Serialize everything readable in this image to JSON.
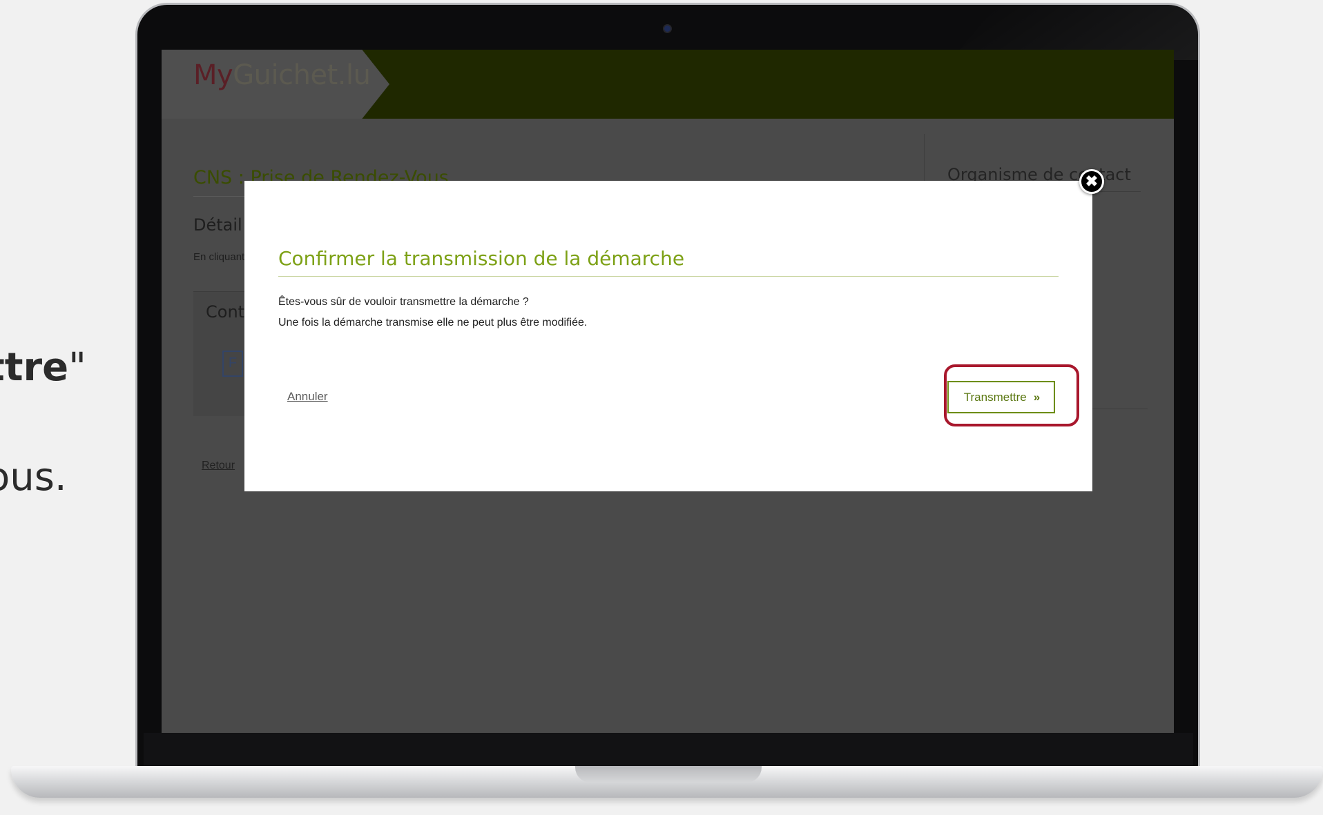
{
  "slide": {
    "line1_bold": "ttre",
    "line1_quote": "\"",
    "line2": "ous."
  },
  "site": {
    "logo_prefix": "My",
    "logo_rest": "Guichet.lu",
    "page_title": "CNS : Prise de Rendez-Vous",
    "section_title": "Détail de la démarche",
    "intro_text": "En cliquant",
    "content_label": "Contenu",
    "file_icon_letter": "F",
    "back_link": "Retour",
    "sidebar_title": "Organisme de contact"
  },
  "modal": {
    "title": "Confirmer la transmission de la démarche",
    "body_line1": "Êtes-vous sûr de vouloir transmettre la démarche ?",
    "body_line2": "Une fois la démarche transmise elle ne peut plus être modifiée.",
    "cancel_label": "Annuler",
    "submit_label": "Transmettre",
    "submit_chevrons": "»",
    "close_icon_char": "✖"
  },
  "colors": {
    "brand_green": "#7da116",
    "highlight_red": "#a8172c",
    "overlay": "#4a4a4a"
  }
}
